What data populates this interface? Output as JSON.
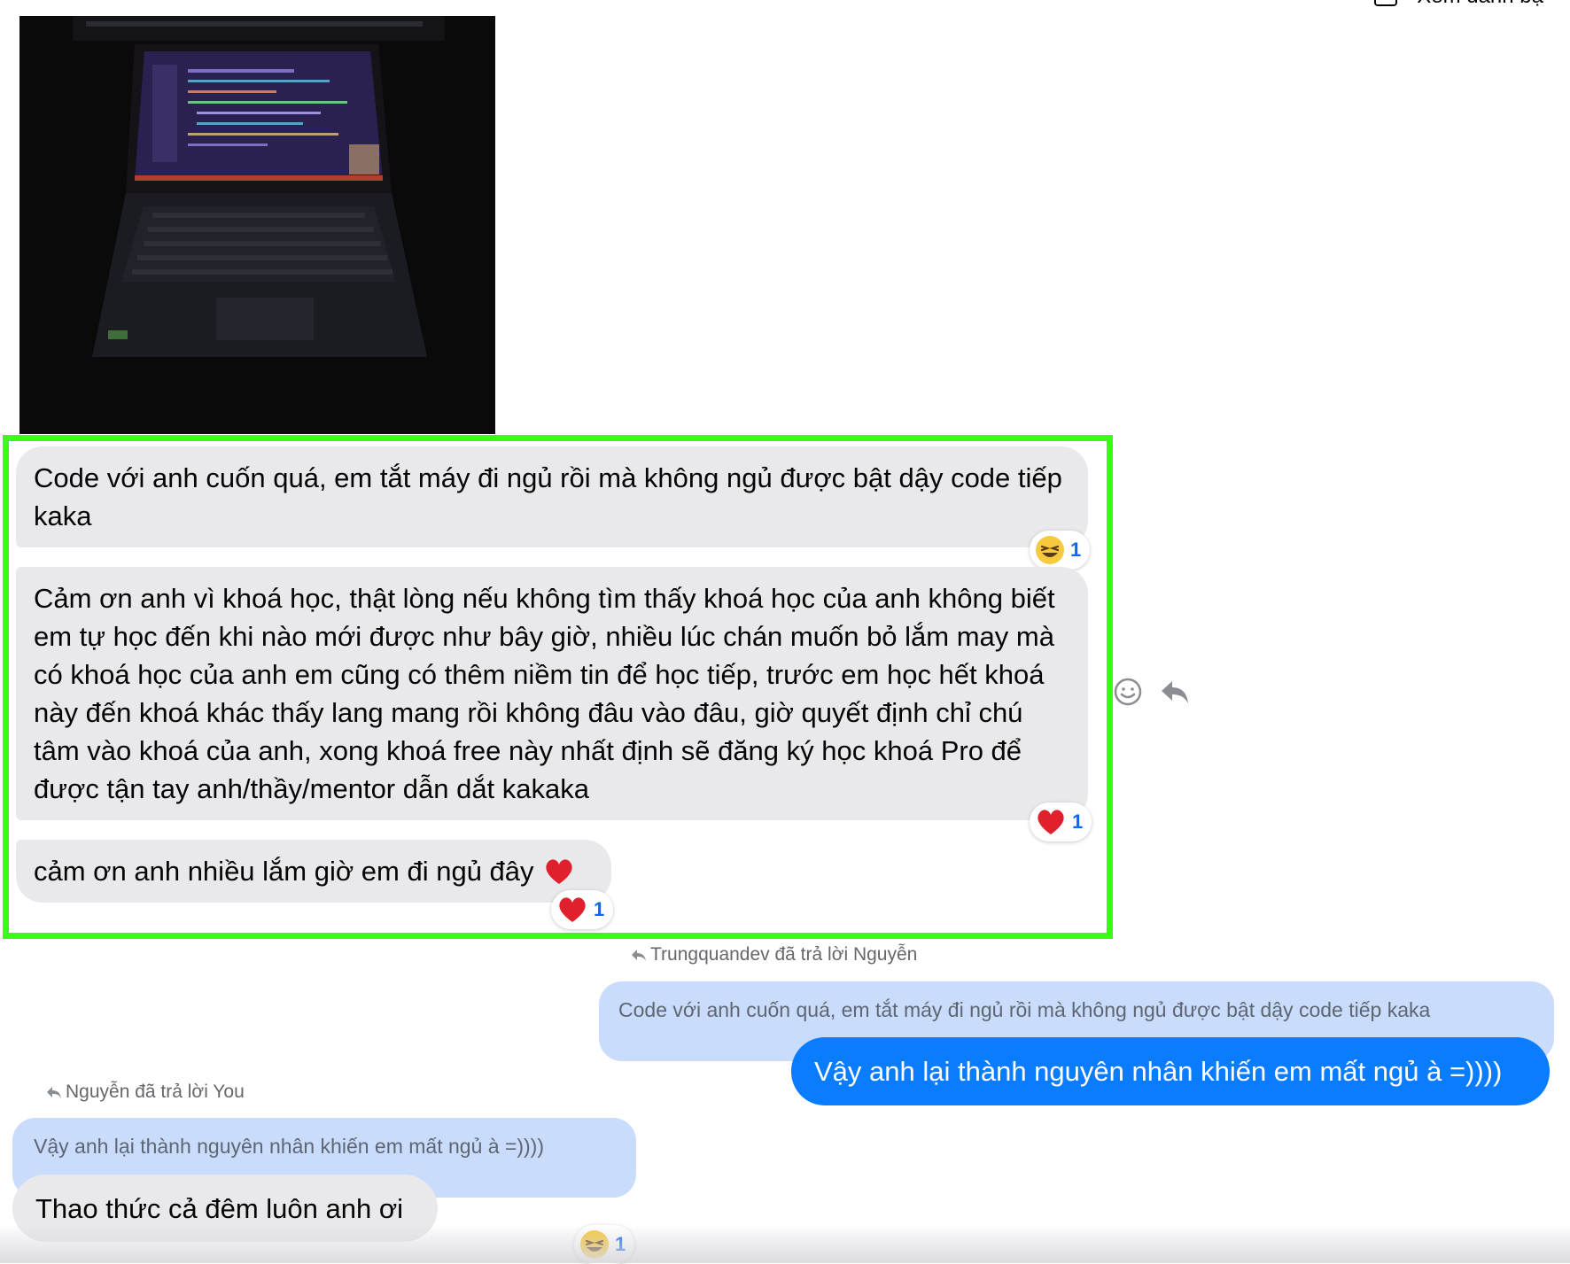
{
  "header": {
    "contacts_link": "Xem danh bạ"
  },
  "messages": {
    "m1": {
      "text": "Code với anh cuốn quá, em tắt máy đi ngủ rồi mà không ngủ được bật dậy code tiếp kaka",
      "reaction": "laughing-face",
      "reaction_count": "1"
    },
    "m2": {
      "text": "Cảm ơn anh vì khoá học, thật lòng nếu không tìm thấy khoá học của anh không biết em tự học đến khi nào mới được như bây giờ, nhiều lúc chán muốn bỏ lắm may mà có khoá học của anh em cũng có thêm niềm tin để học tiếp, trước em học hết khoá này đến khoá khác thấy lang mang rồi không đâu vào đâu, giờ quyết định chỉ chú tâm vào khoá của anh, xong khoá free này nhất định sẽ đăng ký học khoá Pro để được tận tay anh/thầy/mentor dẫn dắt kakaka",
      "reaction": "heart",
      "reaction_count": "1"
    },
    "m3": {
      "text": "cảm ơn anh nhiều lắm giờ em đi ngủ đây",
      "inline_emoji": "heart",
      "reaction": "heart",
      "reaction_count": "1"
    },
    "reply1": {
      "label": "Trungquandev đã trả lời Nguyễn",
      "quoted": "Code với anh cuốn quá, em tắt máy đi ngủ rồi mà không ngủ được bật dậy code tiếp kaka",
      "text": "Vậy anh lại thành nguyên nhân khiến em mất ngủ à =))))"
    },
    "reply2": {
      "label": "Nguyễn đã trả lời You",
      "quoted": "Vậy anh lại thành nguyên nhân khiến em mất ngủ à =))))",
      "text": "Thao thức cả đêm luôn anh ơi",
      "reaction": "laughing-face",
      "reaction_count": "1"
    }
  },
  "colors": {
    "highlight": "#39ff14",
    "outgoing": "#0a7cff",
    "incoming": "#e9e9eb",
    "quoted": "#c9dcfc",
    "reaction_count": "#0a66ff"
  }
}
